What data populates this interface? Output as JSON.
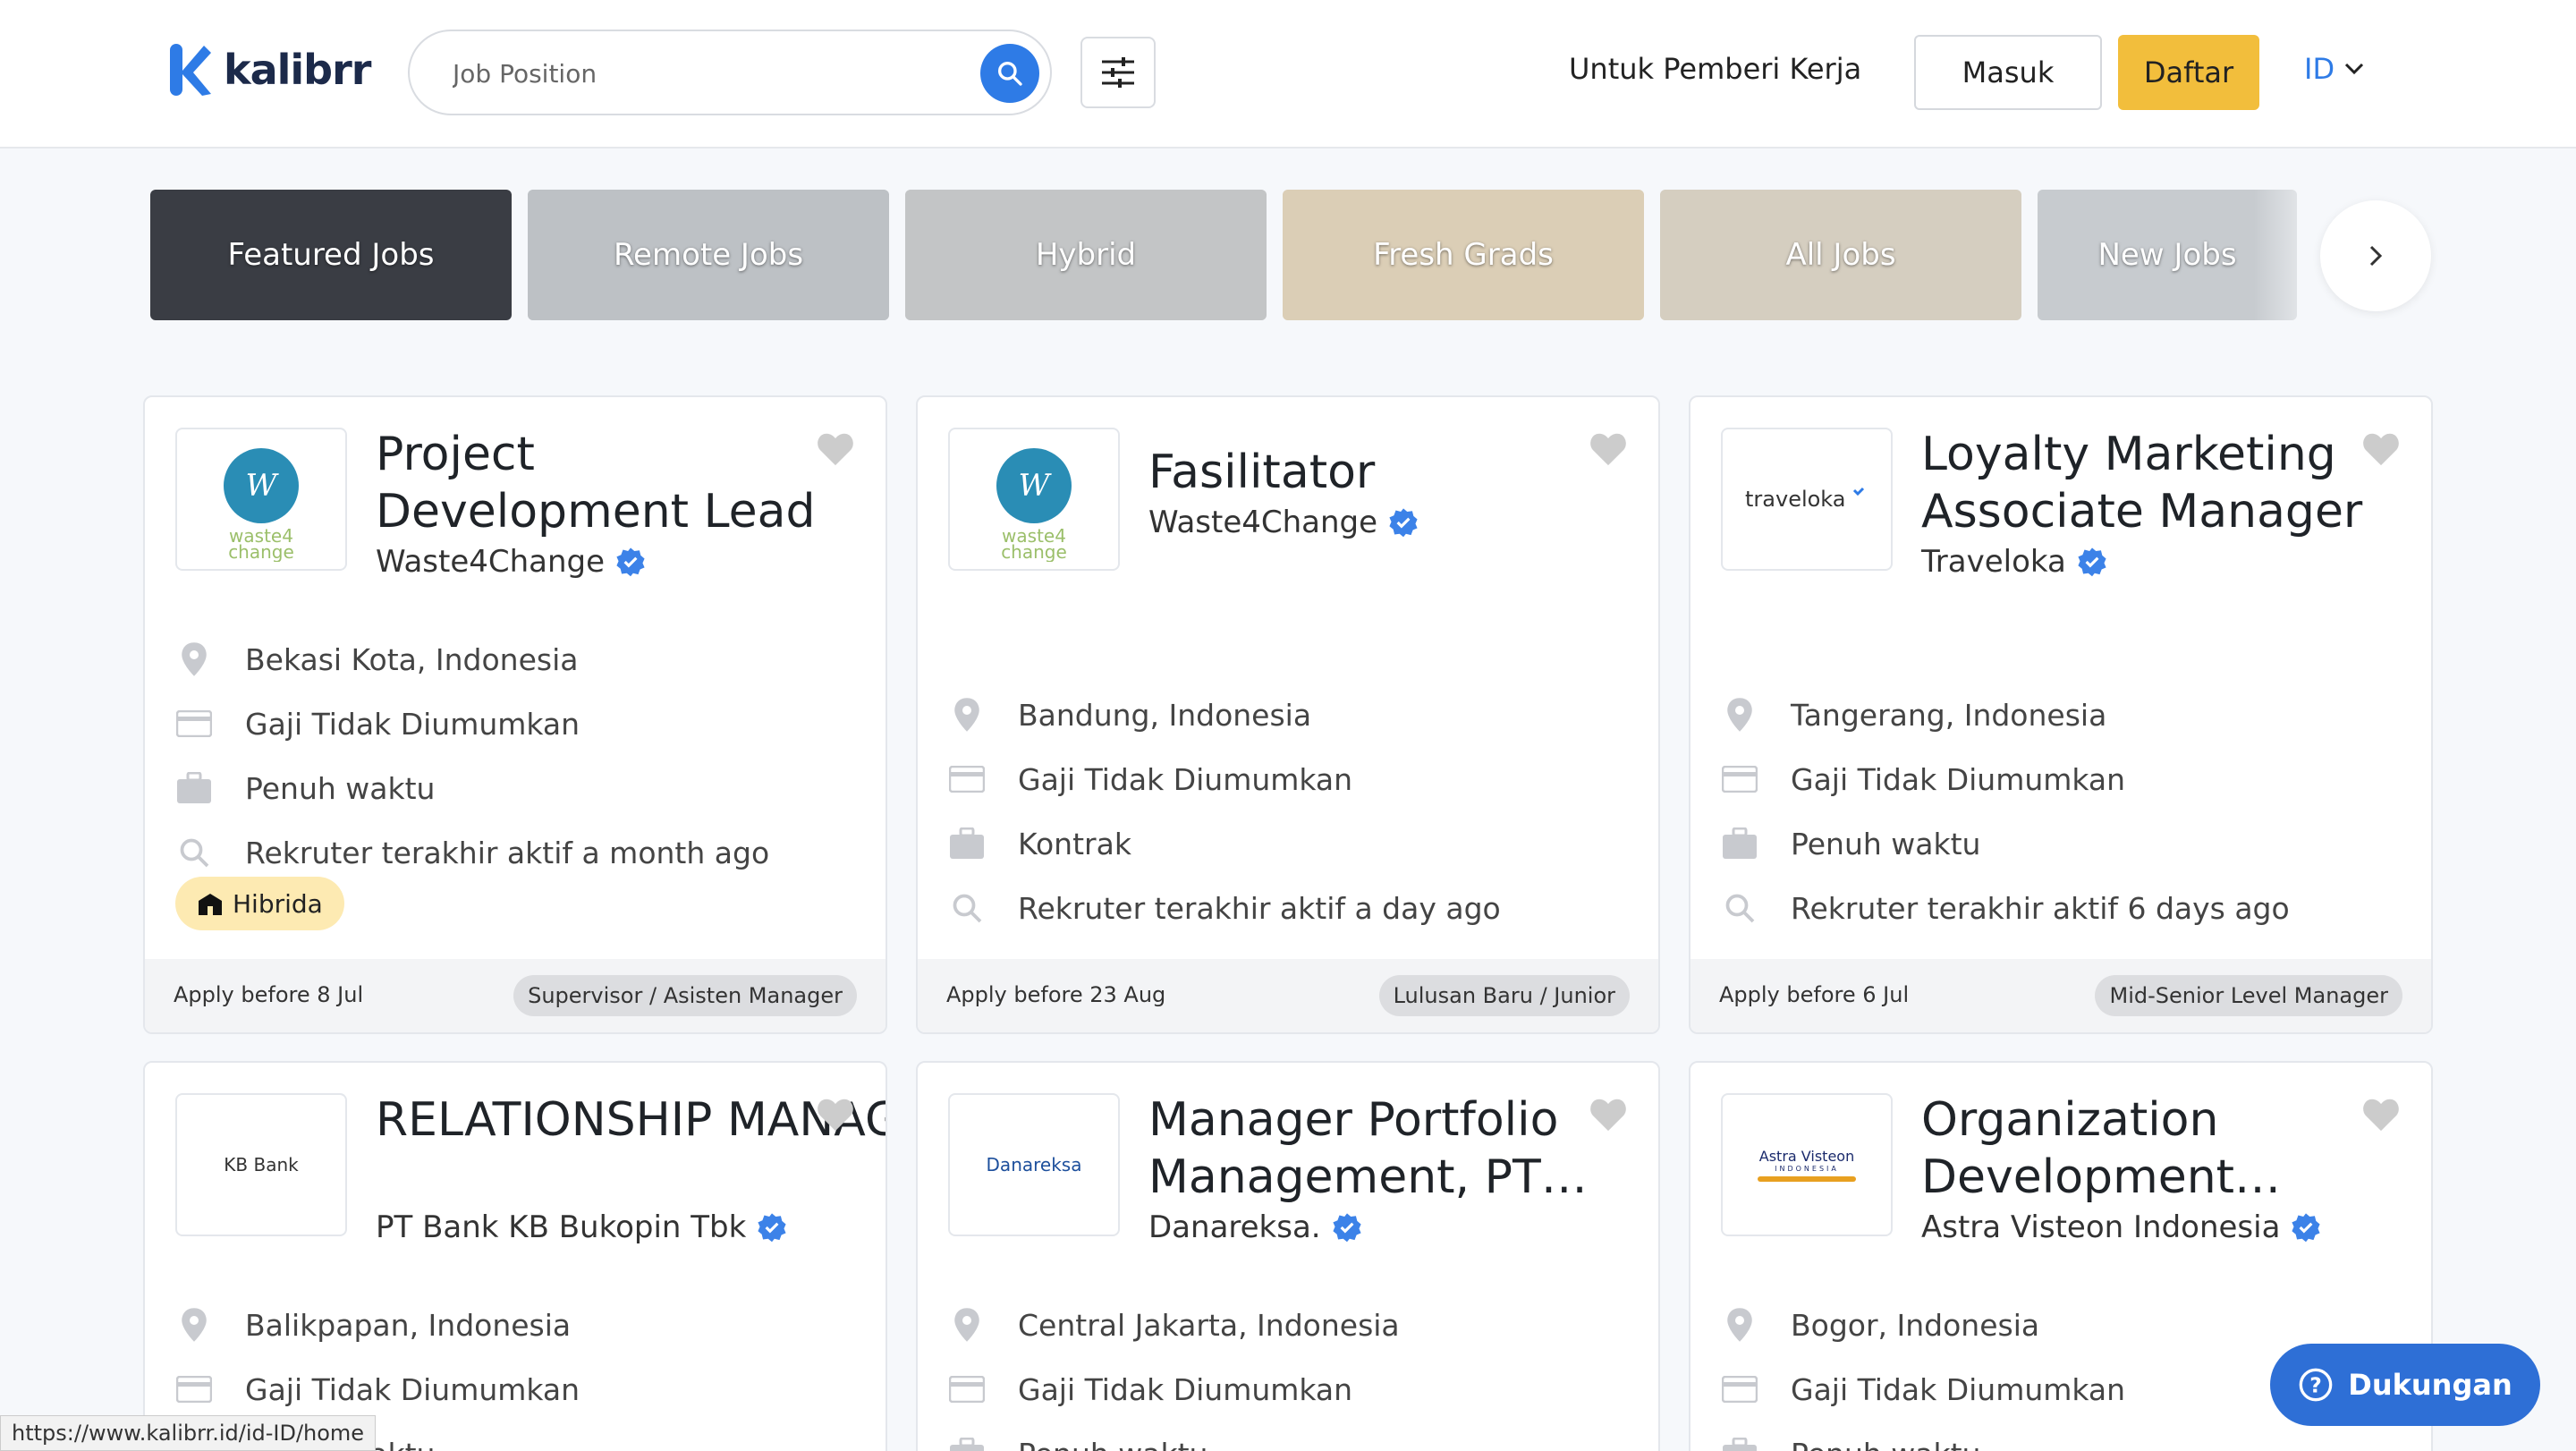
{
  "header": {
    "logo_text": "kalibrr",
    "search_placeholder": "Job Position",
    "employer_link": "Untuk Pemberi Kerja",
    "login": "Masuk",
    "register": "Daftar",
    "language": "ID"
  },
  "categories": [
    {
      "label": "Featured Jobs",
      "bg": "#3a3d44"
    },
    {
      "label": "Remote Jobs",
      "bg": "#9aa0a6"
    },
    {
      "label": "Hybrid",
      "bg": "#a4a6a8"
    },
    {
      "label": "Fresh Grads",
      "bg": "#c8b48f"
    },
    {
      "label": "All Jobs",
      "bg": "#bfb49f"
    },
    {
      "label": "New Jobs",
      "bg": "#a9b0b5"
    }
  ],
  "jobs": [
    {
      "title": "Project Development Lead",
      "company": "Waste4Change",
      "location": "Bekasi Kota, Indonesia",
      "salary": "Gaji Tidak Diumumkan",
      "type": "Penuh waktu",
      "recruiter": "Rekruter terakhir aktif a month ago",
      "tag": "Hibrida",
      "apply": "Apply before 8 Jul",
      "level": "Supervisor / Asisten Manager",
      "logo": "waste4change"
    },
    {
      "title": "Fasilitator",
      "company": "Waste4Change",
      "location": "Bandung, Indonesia",
      "salary": "Gaji Tidak Diumumkan",
      "type": "Kontrak",
      "recruiter": "Rekruter terakhir aktif a day ago",
      "apply": "Apply before 23 Aug",
      "level": "Lulusan Baru / Junior",
      "logo": "waste4change"
    },
    {
      "title": "Loyalty Marketing Associate Manager",
      "company": "Traveloka",
      "location": "Tangerang, Indonesia",
      "salary": "Gaji Tidak Diumumkan",
      "type": "Penuh waktu",
      "recruiter": "Rekruter terakhir aktif 6 days ago",
      "apply": "Apply before 6 Jul",
      "level": "Mid-Senior Level Manager",
      "logo": "traveloka"
    },
    {
      "title": "RELATIONSHIP MANAGER FUNDIN…",
      "company": "PT Bank KB Bukopin Tbk",
      "location": "Balikpapan, Indonesia",
      "salary": "Gaji Tidak Diumumkan",
      "type": "Penuh waktu",
      "logo": "KB Bank"
    },
    {
      "title": "Manager Portfolio Management, PT…",
      "company": "Danareksa.",
      "location": "Central Jakarta, Indonesia",
      "salary": "Gaji Tidak Diumumkan",
      "type": "Penuh waktu",
      "logo": "Danareksa"
    },
    {
      "title": "Organization Development…",
      "company": "Astra Visteon Indonesia",
      "location": "Bogor, Indonesia",
      "salary": "Gaji Tidak Diumumkan",
      "type": "Penuh waktu",
      "logo": "Astra Visteon",
      "logo_sub": "INDONESIA"
    }
  ],
  "support_label": "Dukungan",
  "status_url": "https://www.kalibrr.id/id-ID/home",
  "colors": {
    "brand_blue": "#2e7be6",
    "register_yellow": "#f2be3c",
    "verified": "#3c82e8"
  }
}
